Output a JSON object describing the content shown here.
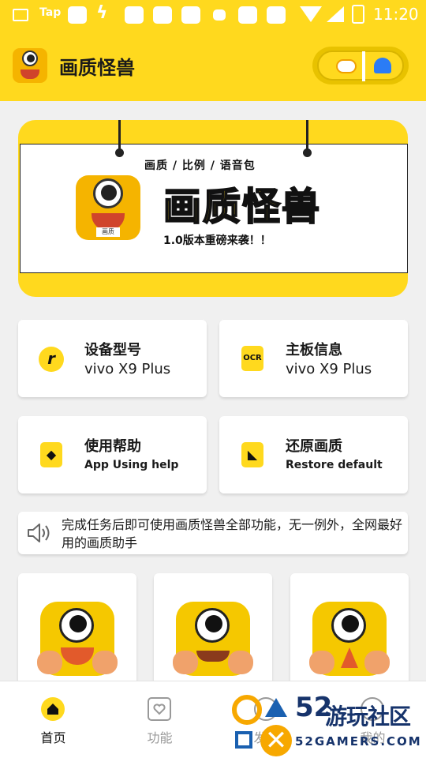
{
  "status_bar": {
    "app_label": "Tap",
    "time": "11:20"
  },
  "header": {
    "title": "画质怪兽"
  },
  "banner": {
    "subtitle": "画质 / 比例 / 语音包",
    "big_title": "画质怪兽",
    "description": "1.0版本重磅来袭！！",
    "icon_tag": "画质"
  },
  "cards": [
    {
      "title": "设备型号",
      "subtitle": "vivo X9 Plus",
      "icon": "speed-icon"
    },
    {
      "title": "主板信息",
      "subtitle": "vivo X9 Plus",
      "icon": "ocr-icon",
      "icon_text": "OCR"
    },
    {
      "title": "使用帮助",
      "subtitle": "App Using help",
      "icon": "help-icon"
    },
    {
      "title": "还原画质",
      "subtitle": "Restore default",
      "icon": "restore-icon"
    }
  ],
  "notice": {
    "text": "完成任务后即可使用画质怪兽全部功能，无一例外，全网最好用的画质助手"
  },
  "tabs": [
    {
      "label": "首页",
      "active": true
    },
    {
      "label": "功能",
      "active": false
    },
    {
      "label": "发现",
      "active": false
    },
    {
      "label": "我的",
      "active": false
    }
  ],
  "watermark": {
    "number": "52",
    "name": "游玩社区",
    "domain": "52GAMERS.COM"
  },
  "colors": {
    "brand_yellow": "#ffd91e",
    "active_tab": "#111111",
    "inactive_tab": "#999999"
  }
}
